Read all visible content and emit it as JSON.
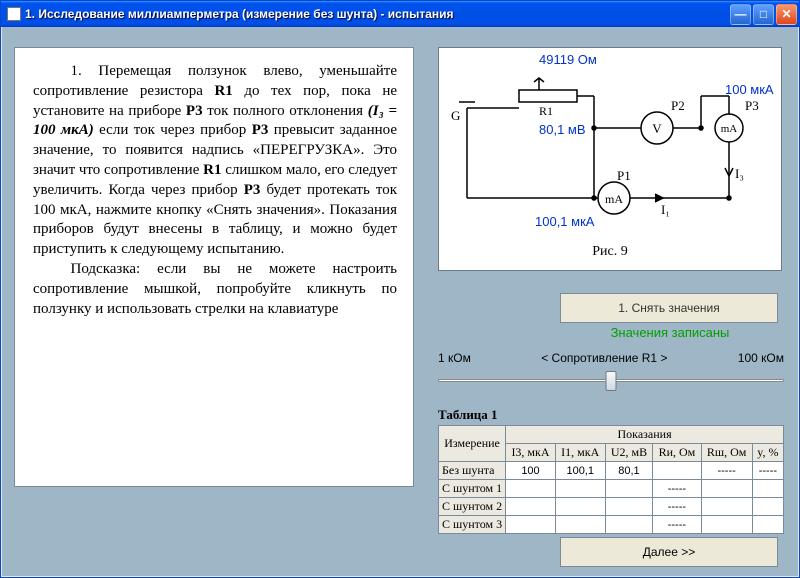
{
  "window": {
    "title": "1. Исследование миллиамперметра (измерение без шунта) - испытания"
  },
  "instructions": {
    "p1_prefix": "1. Перемещая ползунок влево, уменьшайте сопротивление резистора ",
    "p1_r1": "R1",
    "p1_mid1": " до тех пор, пока не установите на приборе ",
    "p1_p3a": "P3",
    "p1_mid2": " ток полного отклонения ",
    "p1_i3": "(I₃ = 100 мкА)",
    "p1_mid3": " если ток через прибор ",
    "p1_p3b": "P3",
    "p1_mid4": " превысит заданное значение, то появится надпись «ПЕРЕГРУЗКА». Это значит что сопротивление ",
    "p1_r1b": "R1",
    "p1_mid5": " слишком мало, его следует увеличить. Когда через прибор ",
    "p1_p3c": "P3",
    "p1_mid6": " будет протекать ток 100 мкА, нажмите кнопку «Снять значения». Показания приборов будут внесены в таблицу, и можно будет приступить к следующему испытанию.",
    "p2": "Подсказка: если вы не можете настроить сопротивление мышкой, попробуйте кликнуть по ползунку и использовать стрелки на клавиатуре"
  },
  "circuit": {
    "r1_ohm": "49119 Ом",
    "p2_mv": "80,1  мВ",
    "p3_ua": "100 мкА",
    "p1_ua": "100,1  мкА",
    "r1_label": "R1",
    "p1_label": "P1",
    "p2_label": "P2",
    "p3_label": "P3",
    "g_label": "G",
    "i1_label": "I₁",
    "i3_label": "I₃",
    "fig": "Рис. 9"
  },
  "take_button": "1. Снять значения",
  "status": "Значения записаны",
  "slider": {
    "min": "1 кОм",
    "label": "< Сопротивление R1 >",
    "max": "100 кОм"
  },
  "table": {
    "title": "Таблица 1",
    "h_measure": "Измерение",
    "h_readings": "Показания",
    "cols": {
      "c1": "I3, мкА",
      "c2": "I1, мкА",
      "c3": "U2, мВ",
      "c4": "Rи, Ом",
      "c5": "Rш, Ом",
      "c6": "y, %"
    },
    "rows": {
      "r1": {
        "name": "Без шунта",
        "v1": "100",
        "v2": "100,1",
        "v3": "80,1",
        "v4": "",
        "v5": "-----",
        "v6": "-----"
      },
      "r2": {
        "name": "С шунтом 1",
        "v1": "",
        "v2": "",
        "v3": "",
        "v4": "-----",
        "v5": "",
        "v6": ""
      },
      "r3": {
        "name": "С шунтом 2",
        "v1": "",
        "v2": "",
        "v3": "",
        "v4": "-----",
        "v5": "",
        "v6": ""
      },
      "r4": {
        "name": "С шунтом 3",
        "v1": "",
        "v2": "",
        "v3": "",
        "v4": "-----",
        "v5": "",
        "v6": ""
      }
    }
  },
  "next_button": "Далее >>"
}
